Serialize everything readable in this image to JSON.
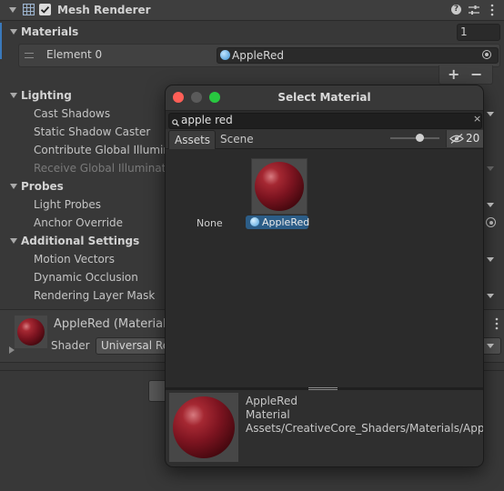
{
  "component": {
    "title": "Mesh Renderer",
    "enabled": true
  },
  "materials": {
    "label": "Materials",
    "count": "1",
    "element_label": "Element 0",
    "element_value": "AppleRed",
    "add_label": "+",
    "remove_label": "−"
  },
  "lighting": {
    "label": "Lighting",
    "cast_shadows": "Cast Shadows",
    "static_shadow_caster": "Static Shadow Caster",
    "contribute_gi": "Contribute Global Illumina",
    "receive_gi": "Receive Global Illuminatio"
  },
  "probes": {
    "label": "Probes",
    "light_probes": "Light Probes",
    "anchor_override": "Anchor Override"
  },
  "additional": {
    "label": "Additional Settings",
    "motion_vectors": "Motion Vectors",
    "dynamic_occlusion": "Dynamic Occlusion",
    "rendering_layer_mask": "Rendering Layer Mask"
  },
  "material_preview": {
    "name": "AppleRed (Material)",
    "shader_label": "Shader",
    "shader_value": "Universal Re"
  },
  "picker": {
    "title": "Select Material",
    "search_value": "apple red",
    "tabs": [
      {
        "label": "Assets",
        "active": true
      },
      {
        "label": "Scene",
        "active": false
      }
    ],
    "visibility_count": "20",
    "none_label": "None",
    "item_label": "AppleRed",
    "detail": {
      "name": "AppleRed",
      "type": "Material",
      "path": "Assets/CreativeCore_Shaders/Materials/AppleRed"
    }
  },
  "icons": [
    "mesh-icon",
    "help-icon",
    "presets-icon",
    "more-icon",
    "material-icon",
    "object-picker-icon",
    "search-icon",
    "clear-icon",
    "eye-slash-icon"
  ],
  "colors": {
    "accent_selection": "#2c5d87",
    "material_red": "#8b1a26"
  }
}
